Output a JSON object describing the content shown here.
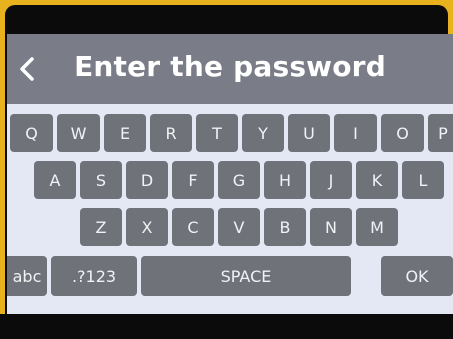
{
  "header": {
    "title": "Enter the password",
    "back_icon": "chevron-left-icon"
  },
  "keyboard": {
    "row1": [
      "Q",
      "W",
      "E",
      "R",
      "T",
      "Y",
      "U",
      "I",
      "O",
      "P"
    ],
    "row2": [
      "A",
      "S",
      "D",
      "F",
      "G",
      "H",
      "J",
      "K",
      "L"
    ],
    "row3": [
      "Z",
      "X",
      "C",
      "V",
      "B",
      "N",
      "M"
    ],
    "abc": "abc",
    "symbols": ".?123",
    "space": "SPACE",
    "ok": "OK"
  },
  "colors": {
    "header_bg": "#7a7d87",
    "key_bg": "#6f7278",
    "keyboard_bg": "#e4e7f4",
    "bezel": "#e8b21f"
  }
}
